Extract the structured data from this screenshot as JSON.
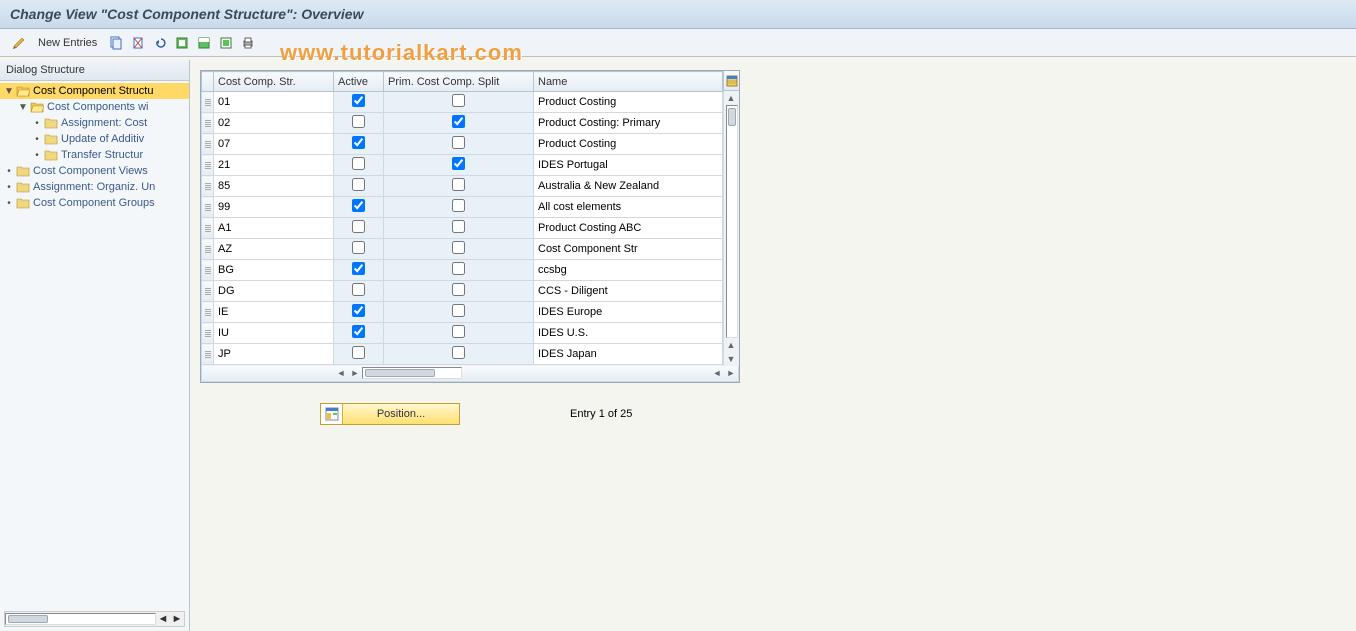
{
  "title": "Change View \"Cost Component Structure\": Overview",
  "toolbar": {
    "new_entries_label": "New Entries"
  },
  "watermark": "www.tutorialkart.com",
  "sidebar": {
    "title": "Dialog Structure",
    "items": [
      {
        "label": "Cost Component Structu",
        "level": 0,
        "open": true,
        "selected": true
      },
      {
        "label": "Cost Components wi",
        "level": 1,
        "open": true,
        "selected": false
      },
      {
        "label": "Assignment: Cost",
        "level": 2,
        "open": false,
        "selected": false
      },
      {
        "label": "Update of Additiv",
        "level": 2,
        "open": false,
        "selected": false
      },
      {
        "label": "Transfer Structur",
        "level": 2,
        "open": false,
        "selected": false
      },
      {
        "label": "Cost Component Views",
        "level": 0,
        "open": false,
        "selected": false
      },
      {
        "label": "Assignment: Organiz. Un",
        "level": 0,
        "open": false,
        "selected": false
      },
      {
        "label": "Cost Component Groups",
        "level": 0,
        "open": false,
        "selected": false
      }
    ]
  },
  "table": {
    "columns": {
      "cost_comp_str": "Cost Comp. Str.",
      "active": "Active",
      "prim_split": "Prim. Cost Comp. Split",
      "name": "Name"
    },
    "rows": [
      {
        "str": "01",
        "active": true,
        "prim": false,
        "name": "Product Costing"
      },
      {
        "str": "02",
        "active": false,
        "prim": true,
        "name": "Product Costing: Primary"
      },
      {
        "str": "07",
        "active": true,
        "prim": false,
        "name": "Product Costing"
      },
      {
        "str": "21",
        "active": false,
        "prim": true,
        "name": "IDES Portugal"
      },
      {
        "str": "85",
        "active": false,
        "prim": false,
        "name": "Australia & New Zealand"
      },
      {
        "str": "99",
        "active": true,
        "prim": false,
        "name": "All cost elements"
      },
      {
        "str": "A1",
        "active": false,
        "prim": false,
        "name": "Product Costing ABC"
      },
      {
        "str": "AZ",
        "active": false,
        "prim": false,
        "name": "Cost Component Str"
      },
      {
        "str": "BG",
        "active": true,
        "prim": false,
        "name": "ccsbg"
      },
      {
        "str": "DG",
        "active": false,
        "prim": false,
        "name": "CCS - Diligent"
      },
      {
        "str": "IE",
        "active": true,
        "prim": false,
        "name": "IDES Europe"
      },
      {
        "str": "IU",
        "active": true,
        "prim": false,
        "name": "IDES U.S."
      },
      {
        "str": "JP",
        "active": false,
        "prim": false,
        "name": "IDES Japan"
      }
    ]
  },
  "footer": {
    "position_label": "Position...",
    "entry_text": "Entry 1 of 25"
  }
}
